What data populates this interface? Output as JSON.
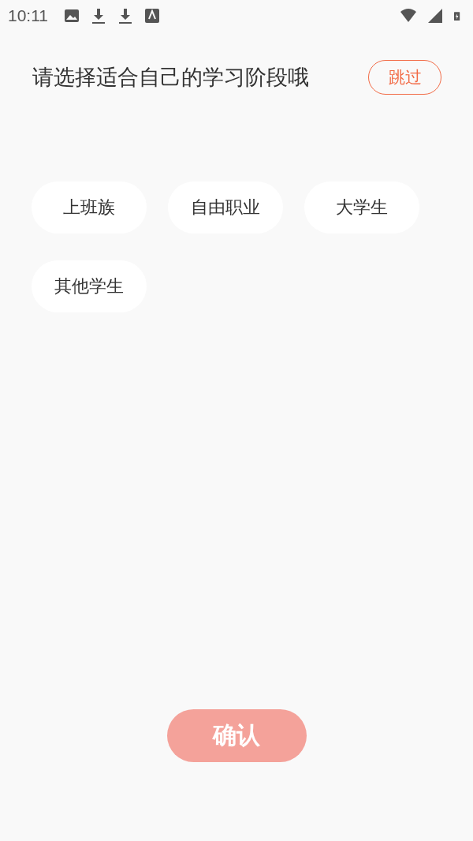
{
  "status_bar": {
    "time": "10:11"
  },
  "header": {
    "title": "请选择适合自己的学习阶段哦",
    "skip_button": "跳过"
  },
  "options": [
    {
      "label": "上班族",
      "selected": false
    },
    {
      "label": "自由职业",
      "selected": false
    },
    {
      "label": "大学生",
      "selected": false
    },
    {
      "label": "其他学生",
      "selected": false
    }
  ],
  "confirm_button": {
    "label": "确认",
    "disabled": true
  }
}
